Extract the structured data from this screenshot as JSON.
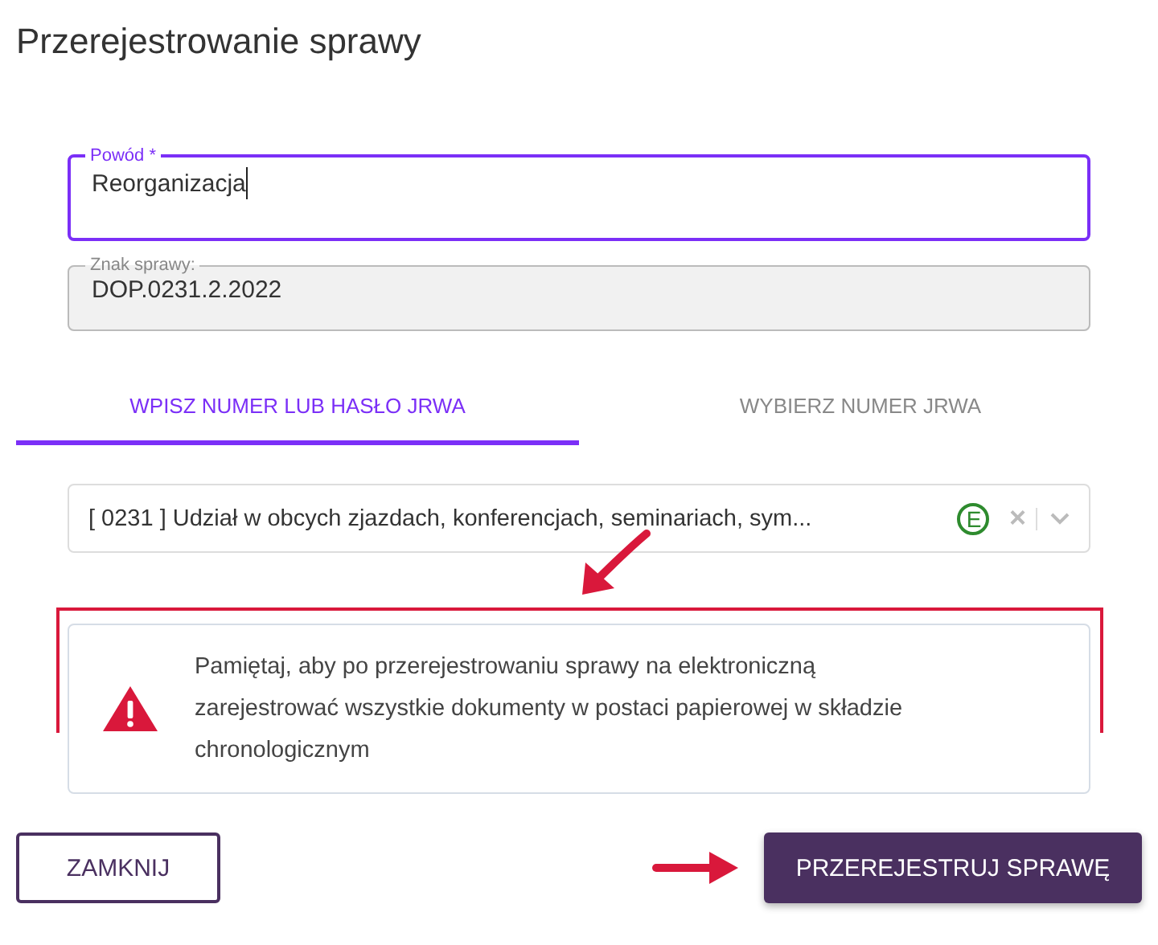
{
  "title": "Przerejestrowanie sprawy",
  "reason": {
    "label": "Powód *",
    "value": "Reorganizacja",
    "focused": true,
    "disabled": false
  },
  "case_number": {
    "label": "Znak sprawy:",
    "value": "DOP.0231.2.2022",
    "focused": false,
    "disabled": true
  },
  "tabs": [
    {
      "label": "WPISZ NUMER LUB HASŁO JRWA",
      "selected": true
    },
    {
      "label": "WYBIERZ NUMER JRWA",
      "selected": false
    }
  ],
  "jrwa_select": {
    "value": "[ 0231 ] Udział w obcych zjazdach, konferencjach, seminariach, sym...",
    "badge": "E",
    "clear": "×"
  },
  "alert": {
    "text": "Pamiętaj, aby po przerejestrowaniu sprawy na elektroniczną zarejestrować wszystkie dokumenty w postaci papierowej w składzie chronologicznym"
  },
  "buttons": [
    {
      "label": "ZAMKNIJ",
      "kind": "outline"
    },
    {
      "label": "PRZEREJESTRUJ SPRAWĘ",
      "kind": "primary"
    }
  ]
}
